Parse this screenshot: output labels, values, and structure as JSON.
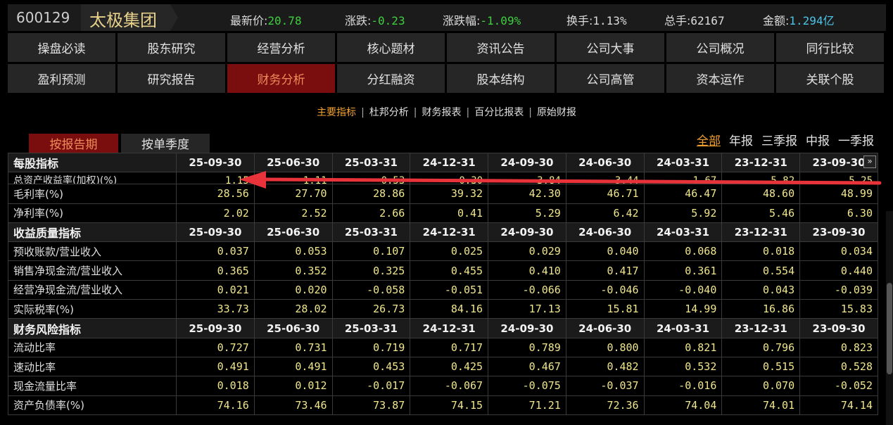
{
  "header": {
    "code": "600129",
    "name": "太极集团",
    "quotes": [
      {
        "label": "最新价:",
        "value": "20.78",
        "color": "#3ecf3e"
      },
      {
        "label": "涨跌:",
        "value": "-0.23",
        "color": "#3ecf3e"
      },
      {
        "label": "涨跌幅:",
        "value": "-1.09%",
        "color": "#3ecf3e"
      },
      {
        "label": "换手:",
        "value": "1.13%",
        "color": "#dcdcdc"
      },
      {
        "label": "总手:",
        "value": "62167",
        "color": "#dcdcdc"
      },
      {
        "label": "金额:",
        "value": "1.294亿",
        "color": "#4cc4e8"
      }
    ]
  },
  "nav": {
    "row1": [
      "操盘必读",
      "股东研究",
      "经营分析",
      "核心题材",
      "资讯公告",
      "公司大事",
      "公司概况",
      "同行比较"
    ],
    "row2": [
      "盈利预测",
      "研究报告",
      "财务分析",
      "分红融资",
      "股本结构",
      "公司高管",
      "资本运作",
      "关联个股"
    ],
    "active": "财务分析"
  },
  "subtabs": {
    "items": [
      "主要指标",
      "杜邦分析",
      "财务报表",
      "百分比报表",
      "原始财报"
    ],
    "active": "主要指标"
  },
  "period_toggle": {
    "on": "按报告期",
    "off": "按单季度"
  },
  "freq": {
    "items": [
      "全部",
      "年报",
      "三季报",
      "中报",
      "一季报"
    ],
    "active": "全部"
  },
  "more_icon": "»",
  "table": {
    "sections": [
      {
        "title": "每股指标",
        "dates": [
          "25-09-30",
          "25-06-30",
          "25-03-31",
          "24-12-31",
          "24-09-30",
          "24-06-30",
          "24-03-31",
          "23-12-31",
          "23-09-30"
        ],
        "rows": [
          {
            "label": "总资产收益率(加权)(%)",
            "values": [
              "1.15",
              "1.11",
              "0.53",
              "0.30",
              "3.84",
              "3.44",
              "1.67",
              "5.82",
              "5.25"
            ],
            "clipped": true
          },
          {
            "label": "毛利率(%)",
            "values": [
              "28.56",
              "27.70",
              "28.86",
              "39.32",
              "42.30",
              "46.71",
              "46.47",
              "48.60",
              "48.99"
            ]
          },
          {
            "label": "净利率(%)",
            "values": [
              "2.02",
              "2.52",
              "2.66",
              "0.41",
              "5.29",
              "6.42",
              "5.92",
              "5.46",
              "6.30"
            ]
          }
        ]
      },
      {
        "title": "收益质量指标",
        "dates": [
          "25-09-30",
          "25-06-30",
          "25-03-31",
          "24-12-31",
          "24-09-30",
          "24-06-30",
          "24-03-31",
          "23-12-31",
          "23-09-30"
        ],
        "rows": [
          {
            "label": "预收账款/营业收入",
            "values": [
              "0.037",
              "0.053",
              "0.107",
              "0.025",
              "0.029",
              "0.040",
              "0.068",
              "0.018",
              "0.034"
            ]
          },
          {
            "label": "销售净现金流/营业收入",
            "values": [
              "0.365",
              "0.352",
              "0.325",
              "0.455",
              "0.410",
              "0.417",
              "0.361",
              "0.554",
              "0.440"
            ]
          },
          {
            "label": "经营净现金流/营业收入",
            "values": [
              "0.021",
              "0.020",
              "-0.058",
              "-0.051",
              "-0.066",
              "-0.046",
              "-0.040",
              "0.043",
              "-0.039"
            ]
          },
          {
            "label": "实际税率(%)",
            "values": [
              "33.73",
              "28.02",
              "26.73",
              "84.16",
              "17.13",
              "15.81",
              "14.99",
              "16.86",
              "15.83"
            ]
          }
        ]
      },
      {
        "title": "财务风险指标",
        "dates": [
          "25-09-30",
          "25-06-30",
          "25-03-31",
          "24-12-31",
          "24-09-30",
          "24-06-30",
          "24-03-31",
          "23-12-31",
          "23-09-30"
        ],
        "rows": [
          {
            "label": "流动比率",
            "values": [
              "0.727",
              "0.731",
              "0.719",
              "0.717",
              "0.789",
              "0.800",
              "0.821",
              "0.796",
              "0.823"
            ]
          },
          {
            "label": "速动比率",
            "values": [
              "0.491",
              "0.491",
              "0.453",
              "0.425",
              "0.467",
              "0.482",
              "0.532",
              "0.515",
              "0.528"
            ]
          },
          {
            "label": "现金流量比率",
            "values": [
              "0.018",
              "0.012",
              "-0.017",
              "-0.067",
              "-0.075",
              "-0.037",
              "-0.016",
              "0.070",
              "-0.052"
            ]
          },
          {
            "label": "资产负债率(%)",
            "values": [
              "74.16",
              "73.46",
              "73.87",
              "74.15",
              "71.21",
              "72.36",
              "74.04",
              "74.01",
              "74.14"
            ]
          }
        ]
      }
    ]
  },
  "annotation": {
    "type": "arrow",
    "color": "#e8333a"
  }
}
